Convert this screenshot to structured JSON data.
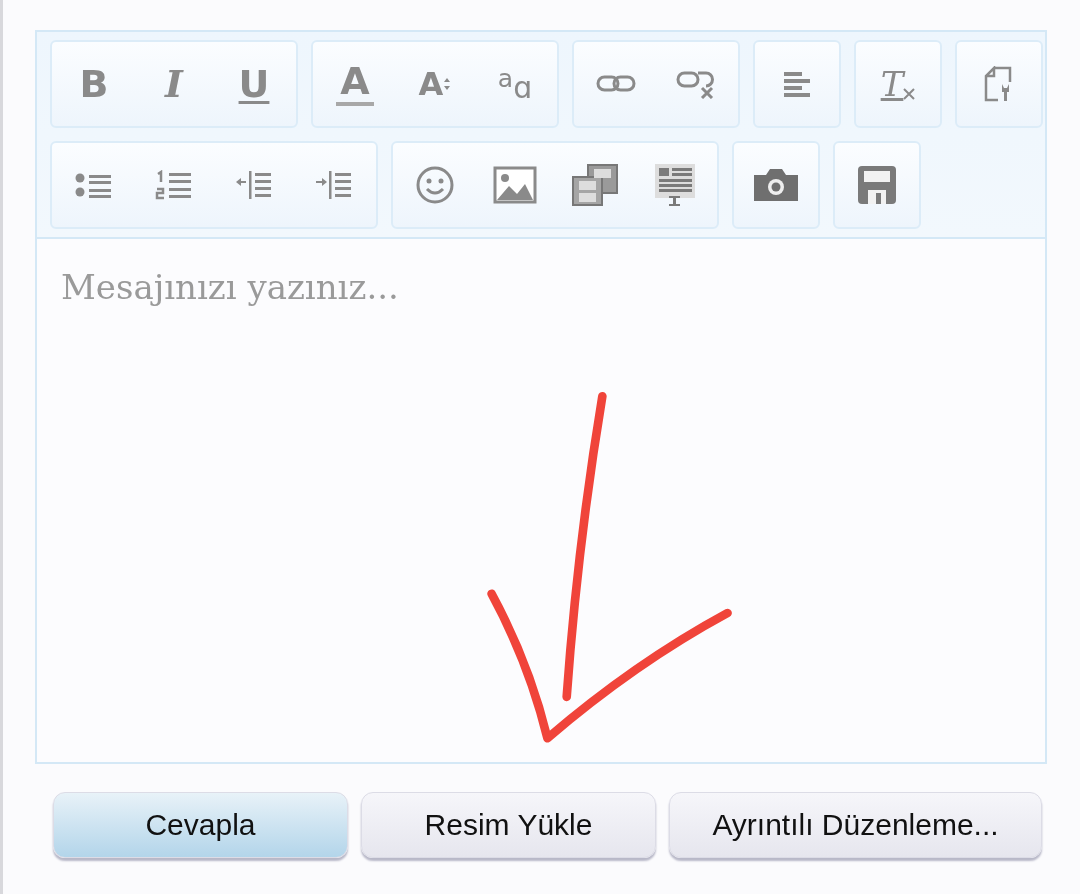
{
  "toolbar": {
    "rows": [
      [
        {
          "items": [
            {
              "kind": "bold",
              "label": "B"
            },
            {
              "kind": "italic",
              "label": "I"
            },
            {
              "kind": "underline",
              "label": "U"
            }
          ]
        },
        {
          "items": [
            {
              "kind": "color",
              "label": "A"
            },
            {
              "kind": "size",
              "label": "A"
            },
            {
              "kind": "case",
              "label": "$^{a}$ɑ"
            }
          ]
        },
        {
          "items": [
            {
              "kind": "link"
            },
            {
              "kind": "unlink"
            }
          ]
        },
        {
          "items": [
            {
              "kind": "align"
            }
          ]
        },
        {
          "items": [
            {
              "kind": "clear",
              "label": "T"
            }
          ]
        },
        {
          "items": [
            {
              "kind": "source"
            }
          ]
        }
      ],
      [
        {
          "items": [
            {
              "kind": "bullets"
            },
            {
              "kind": "numbers"
            },
            {
              "kind": "outdent"
            },
            {
              "kind": "indent"
            }
          ]
        },
        {
          "items": [
            {
              "kind": "smiley"
            },
            {
              "kind": "image"
            },
            {
              "kind": "video"
            },
            {
              "kind": "template"
            }
          ]
        },
        {
          "items": [
            {
              "kind": "camera"
            }
          ]
        },
        {
          "items": [
            {
              "kind": "save"
            }
          ]
        }
      ]
    ]
  },
  "editor": {
    "placeholder": "Mesajınızı yazınız..."
  },
  "buttons": [
    {
      "label": "Cevapla",
      "primary": true
    },
    {
      "label": "Resim Yükle",
      "primary": false
    },
    {
      "label": "Ayrıntılı Düzenleme...",
      "primary": false
    }
  ]
}
